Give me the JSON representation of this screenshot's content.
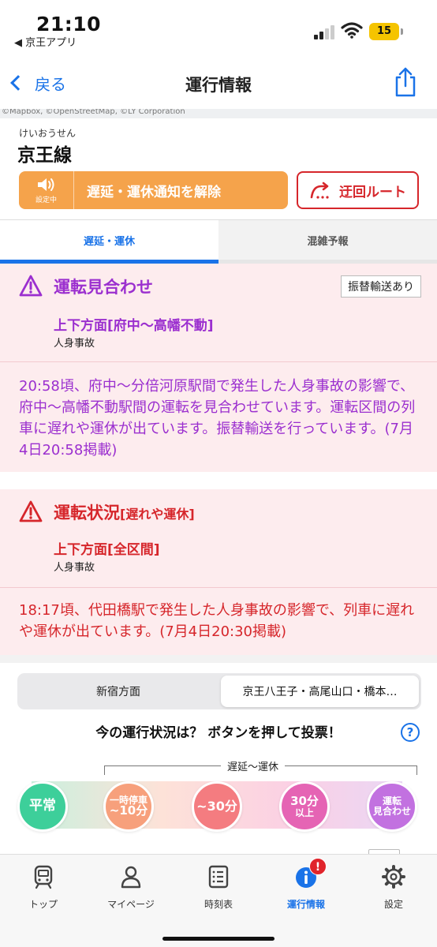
{
  "status_bar": {
    "time": "21:10",
    "back_app": "◀ 京王アプリ",
    "battery": "15"
  },
  "nav": {
    "back_label": "戻る",
    "title": "運行情報"
  },
  "map": {
    "attribution": "©Mapbox, ©OpenStreetMap, ©LY Corporation"
  },
  "line": {
    "ruby": "けいおうせん",
    "name": "京王線",
    "notify_sub": "設定中",
    "notify_label": "遅延・運休通知を解除",
    "route_label": "迂回ルート"
  },
  "tabs": [
    {
      "label": "遅延・運休"
    },
    {
      "label": "混雑予報"
    }
  ],
  "alerts": [
    {
      "title": "運転見合わせ",
      "badge": "振替輸送あり",
      "direction": "上下方面[府中〜高幡不動]",
      "cause": "人身事故",
      "body": "20:58頃、府中〜分倍河原駅間で発生した人身事故の影響で、府中〜高幡不動駅間の運転を見合わせています。運転区間の列車に遅れや運休が出ています。振替輸送を行っています。(7月4日20:58掲載)",
      "color": "#9b2fcf"
    },
    {
      "title": "運転状況",
      "title_suffix": "[遅れや運休]",
      "direction": "上下方面[全区間]",
      "cause": "人身事故",
      "body": "18:17頃、代田橋駅で発生した人身事故の影響で、列車に遅れや運休が出ています。(7月4日20:30掲載)",
      "color": "#d6262b"
    }
  ],
  "vote": {
    "segment_left": "新宿方面",
    "segment_right": "京王八王子・高尾山口・橋本…",
    "question": "今の運行状況は？ ボタンを押して投票！",
    "help": "?",
    "delay_label": "遅延〜運休",
    "buttons": [
      {
        "line1": "平常",
        "line2": "",
        "color": "#3dcf9a"
      },
      {
        "line1": "一時停車",
        "line2": "~10分",
        "color": "#f7a07c"
      },
      {
        "line1": "~30分",
        "line2": "",
        "color": "#f47c80"
      },
      {
        "line1": "30分",
        "line2": "以上",
        "color": "#e564b4"
      },
      {
        "line1": "運転",
        "line2": "見合わせ",
        "color": "#c271e0"
      }
    ]
  },
  "tab_bar": {
    "items": [
      {
        "label": "トップ",
        "icon": "train-icon"
      },
      {
        "label": "マイページ",
        "icon": "person-icon"
      },
      {
        "label": "時刻表",
        "icon": "timetable-icon"
      },
      {
        "label": "運行情報",
        "icon": "info-icon",
        "badge": "!"
      },
      {
        "label": "設定",
        "icon": "gear-icon"
      }
    ]
  }
}
